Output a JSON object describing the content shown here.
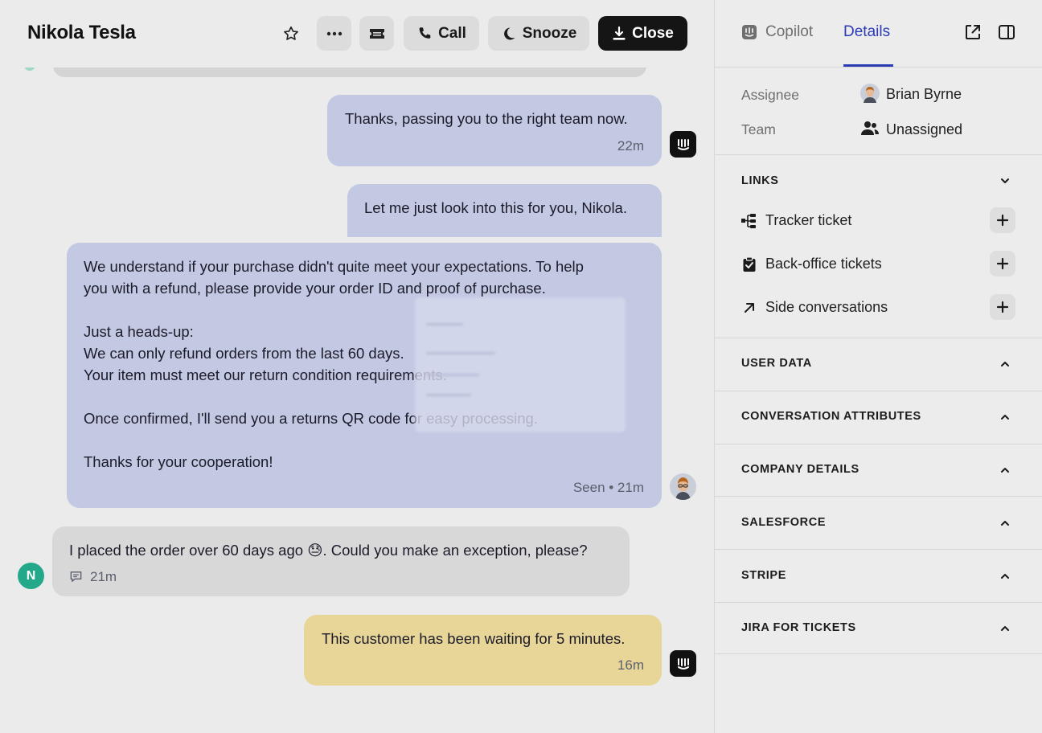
{
  "header": {
    "title": "Nikola Tesla",
    "buttons": {
      "call": "Call",
      "snooze": "Snooze",
      "close": "Close"
    },
    "icons": [
      "star-icon",
      "more-icon",
      "ticket-icon",
      "phone-icon",
      "snooze-icon",
      "close-tray-icon"
    ]
  },
  "messages": [
    {
      "author": "fin",
      "text": "Thanks, passing you to the right team now.",
      "meta": "22m"
    },
    {
      "author": "fin",
      "text": "Let me just look into this for you, Nikola."
    },
    {
      "author": "admin",
      "text": "We understand if your purchase didn't quite meet your expectations. To help\nyou with a refund, please provide your order ID and proof of purchase.\n\nJust a heads-up:\nWe can only refund orders from the last 60 days.\nYour item must meet our return condition requirements.\n\nOnce confirmed, I'll send you a returns QR code for easy processing.\n\nThanks for your cooperation!",
      "meta": "Seen • 21m"
    },
    {
      "author": "user",
      "avatar_letter": "N",
      "text": "I placed the order over 60 days ago 😓. Could you make an exception, please?",
      "meta": "21m"
    },
    {
      "author": "fin",
      "type": "note",
      "text": "This customer has been waiting for 5 minutes.",
      "meta": "16m"
    }
  ],
  "sidebar": {
    "tabs": {
      "copilot": "Copilot",
      "details": "Details"
    },
    "active_tab": "Details",
    "assignee": {
      "label": "Assignee",
      "value": "Brian Byrne"
    },
    "team": {
      "label": "Team",
      "value": "Unassigned"
    },
    "links": {
      "title": "LINKS",
      "items": [
        {
          "label": "Tracker ticket",
          "icon": "tracker-icon"
        },
        {
          "label": "Back-office tickets",
          "icon": "clipboard-icon"
        },
        {
          "label": "Side conversations",
          "icon": "arrow-up-right-icon"
        }
      ]
    },
    "sections": [
      "USER DATA",
      "CONVERSATION ATTRIBUTES",
      "COMPANY DETAILS",
      "SALESFORCE",
      "STRIPE",
      "JIRA FOR TICKETS"
    ]
  },
  "colors": {
    "accent": "#2b3ab5",
    "admin_bubble": "#c3c8e3",
    "user_bubble": "#d8d8d8",
    "note_bubble": "#e8d698",
    "avatar_user": "#23a98a"
  }
}
